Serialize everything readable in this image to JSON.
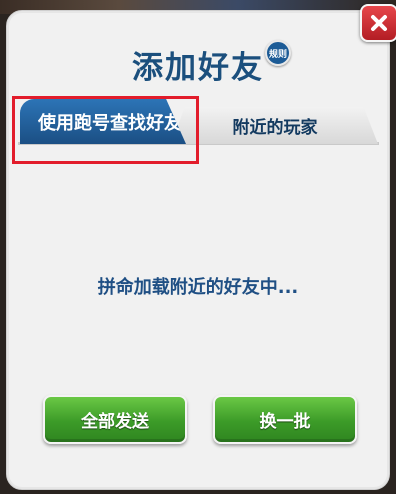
{
  "dialog": {
    "title": "添加好友",
    "rule_badge": "规则"
  },
  "tabs": [
    {
      "label": "使用跑号查找好友",
      "active": true
    },
    {
      "label": "附近的玩家",
      "active": false
    }
  ],
  "status": {
    "loading_text": "拼命加载附近的好友中..."
  },
  "buttons": {
    "send_all": "全部发送",
    "refresh": "换一批"
  },
  "colors": {
    "accent": "#1b4f7d",
    "tab_active": "#2c74b6",
    "button_green": "#3c9b28",
    "close_red": "#cf2b31",
    "highlight_red": "#e21c2b"
  },
  "icons": {
    "close": "close-icon"
  }
}
